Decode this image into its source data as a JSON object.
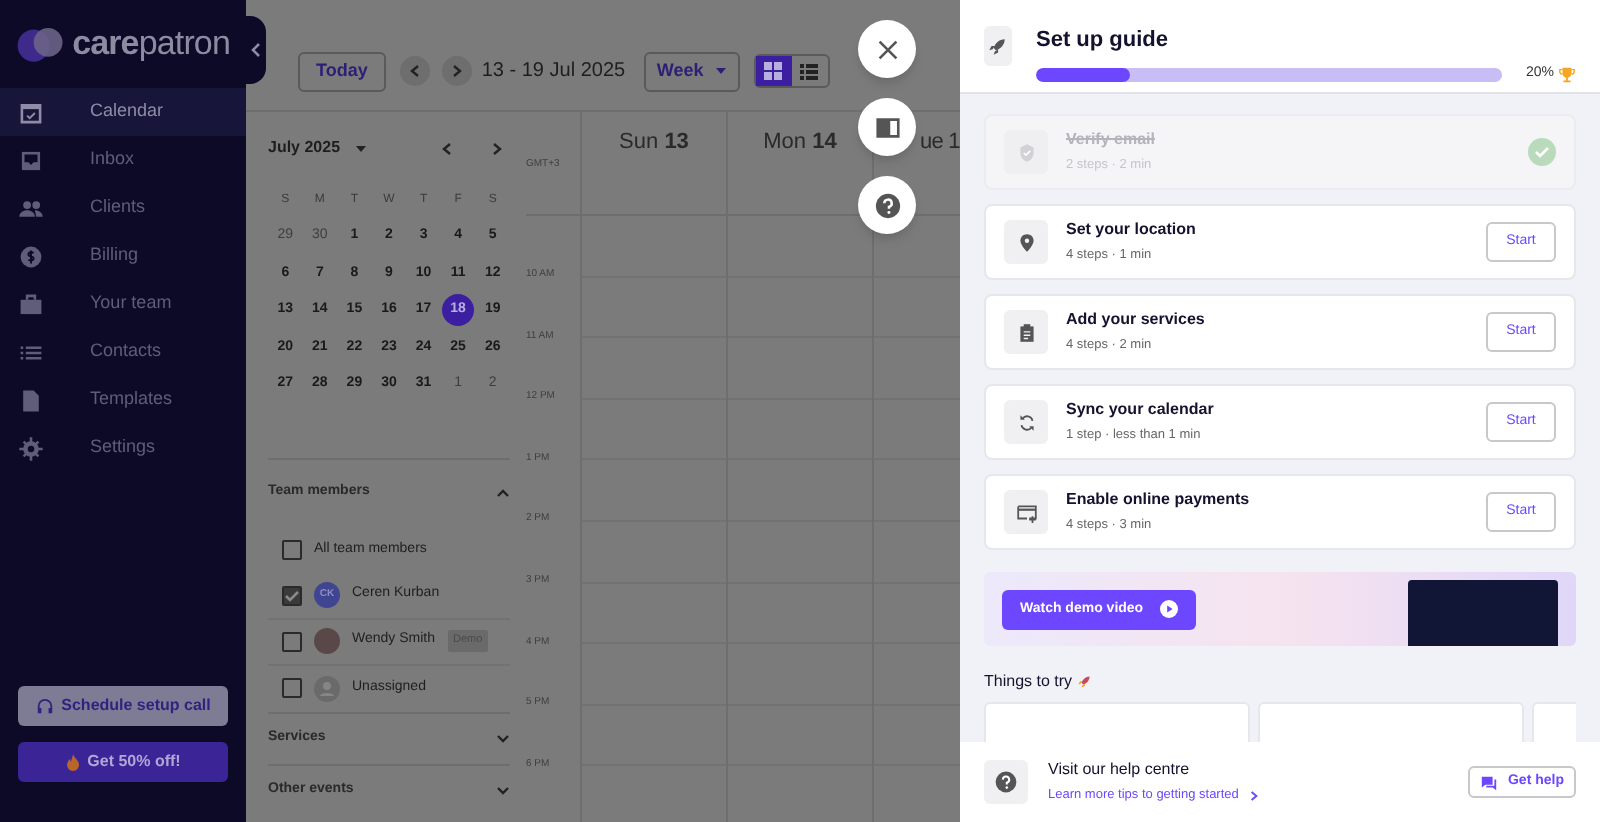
{
  "sidebar": {
    "logo": "**care**patron",
    "items": [
      {
        "label": "Calendar",
        "selected": true
      },
      {
        "label": "Inbox",
        "selected": false
      },
      {
        "label": "Clients",
        "selected": false
      },
      {
        "label": "Billing",
        "selected": false
      },
      {
        "label": "Your team",
        "selected": false
      },
      {
        "label": "Contacts",
        "selected": false
      },
      {
        "label": "Templates",
        "selected": false
      },
      {
        "label": "Settings",
        "selected": false
      }
    ],
    "setup_call_button": "Schedule setup call",
    "offer_button": "Get 50% off!"
  },
  "toolbar": {
    "today_button": "Today",
    "date_range": "13 - 19 Jul 2025",
    "view_select": "Week",
    "view_toggle": [
      {
        "kind": "grid",
        "selected": true
      },
      {
        "kind": "list",
        "selected": false
      }
    ]
  },
  "mini_calendar": {
    "month": "July 2025",
    "weekdays": [
      "S",
      "M",
      "T",
      "W",
      "T",
      "F",
      "S"
    ],
    "weeks": [
      {
        "days": [
          {
            "label": "29",
            "muted": true,
            "selected": false
          },
          {
            "label": "30",
            "muted": true,
            "selected": false
          },
          {
            "label": "1",
            "muted": false,
            "selected": false
          },
          {
            "label": "2",
            "muted": false,
            "selected": false
          },
          {
            "label": "3",
            "muted": false,
            "selected": false
          },
          {
            "label": "4",
            "muted": false,
            "selected": false
          },
          {
            "label": "5",
            "muted": false,
            "selected": false
          }
        ]
      },
      {
        "days": [
          {
            "label": "6",
            "muted": false,
            "selected": false
          },
          {
            "label": "7",
            "muted": false,
            "selected": false
          },
          {
            "label": "8",
            "muted": false,
            "selected": false
          },
          {
            "label": "9",
            "muted": false,
            "selected": false
          },
          {
            "label": "10",
            "muted": false,
            "selected": false
          },
          {
            "label": "11",
            "muted": false,
            "selected": false
          },
          {
            "label": "12",
            "muted": false,
            "selected": false
          }
        ]
      },
      {
        "days": [
          {
            "label": "13",
            "muted": false,
            "selected": false
          },
          {
            "label": "14",
            "muted": false,
            "selected": false
          },
          {
            "label": "15",
            "muted": false,
            "selected": false
          },
          {
            "label": "16",
            "muted": false,
            "selected": false
          },
          {
            "label": "17",
            "muted": false,
            "selected": false
          },
          {
            "label": "18",
            "muted": false,
            "selected": true
          },
          {
            "label": "19",
            "muted": false,
            "selected": false
          }
        ]
      },
      {
        "days": [
          {
            "label": "20",
            "muted": false,
            "selected": false
          },
          {
            "label": "21",
            "muted": false,
            "selected": false
          },
          {
            "label": "22",
            "muted": false,
            "selected": false
          },
          {
            "label": "23",
            "muted": false,
            "selected": false
          },
          {
            "label": "24",
            "muted": false,
            "selected": false
          },
          {
            "label": "25",
            "muted": false,
            "selected": false
          },
          {
            "label": "26",
            "muted": false,
            "selected": false
          }
        ]
      },
      {
        "days": [
          {
            "label": "27",
            "muted": false,
            "selected": false
          },
          {
            "label": "28",
            "muted": false,
            "selected": false
          },
          {
            "label": "29",
            "muted": false,
            "selected": false
          },
          {
            "label": "30",
            "muted": false,
            "selected": false
          },
          {
            "label": "31",
            "muted": false,
            "selected": false
          },
          {
            "label": "1",
            "muted": true,
            "selected": false
          },
          {
            "label": "2",
            "muted": true,
            "selected": false
          }
        ]
      }
    ]
  },
  "team_members": {
    "title": "Team members",
    "expanded": true,
    "items": [
      {
        "name": "All team members",
        "kind": "group",
        "checked": false
      },
      {
        "name": "Ceren Kurban",
        "kind": "initials",
        "initials": "CK",
        "checked": true
      },
      {
        "name": "Wendy Smith",
        "kind": "photo",
        "badge": "Demo",
        "checked": false
      },
      {
        "name": "Unassigned",
        "kind": "person",
        "checked": false
      }
    ]
  },
  "filter_sections": [
    {
      "title": "Services",
      "expanded": false
    },
    {
      "title": "Other events",
      "expanded": false
    }
  ],
  "week_view": {
    "timezone": "GMT+3",
    "days": [
      "Sun **13**",
      "Mon **14**",
      "ue 1"
    ],
    "hours": [
      "10 AM",
      "11 AM",
      "12 PM",
      "1 PM",
      "2 PM",
      "3 PM",
      "4 PM",
      "5 PM",
      "6 PM"
    ]
  },
  "setup_guide": {
    "title": "Set up guide",
    "level": 0.2,
    "percent": "20%",
    "tasks": [
      {
        "title": "Verify email",
        "meta": "2 steps · 2 min",
        "done": true
      },
      {
        "title": "Set your location",
        "meta": "4 steps · 1 min",
        "done": false,
        "button": "Start"
      },
      {
        "title": "Add your services",
        "meta": "4 steps · 2 min",
        "done": false,
        "button": "Start"
      },
      {
        "title": "Sync your calendar",
        "meta": "1 step · less than 1 min",
        "done": false,
        "button": "Start"
      },
      {
        "title": "Enable online payments",
        "meta": "4 steps · 3 min",
        "done": false,
        "button": "Start"
      }
    ],
    "demo_button": "Watch demo video",
    "things_title": "Things to try"
  },
  "help": {
    "title": "Visit our help centre",
    "link": "Learn more tips to getting started",
    "button": "Get help"
  }
}
